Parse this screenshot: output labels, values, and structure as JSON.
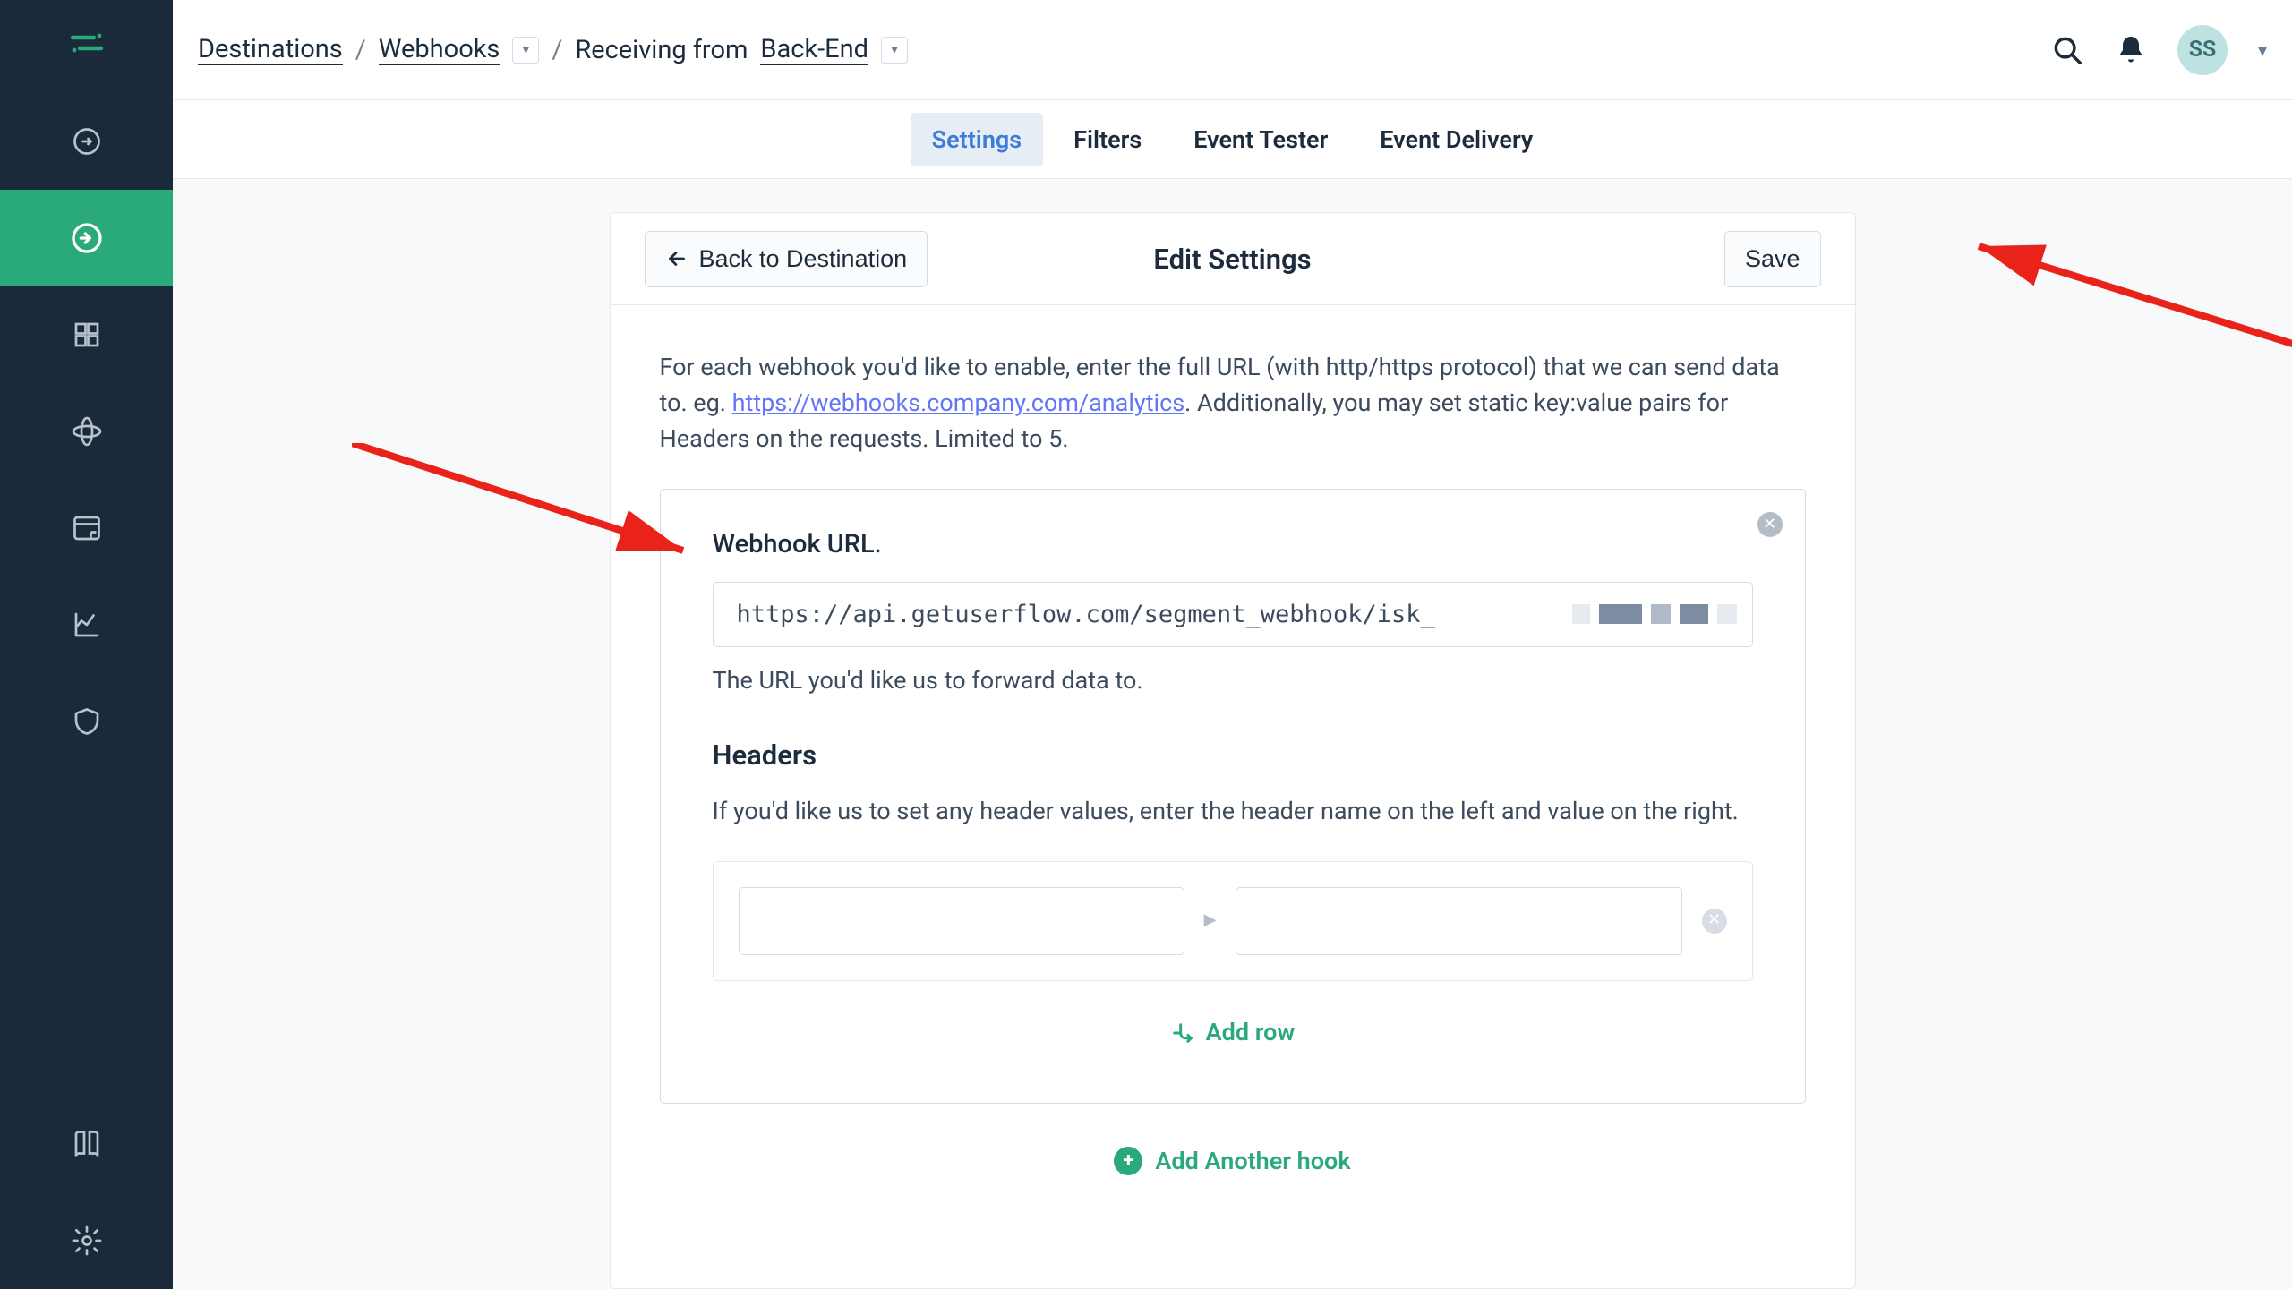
{
  "breadcrumb": {
    "destinations": "Destinations",
    "webhooks": "Webhooks",
    "receiving_from": "Receiving from",
    "backend": "Back-End"
  },
  "user": {
    "initials": "SS"
  },
  "tabs": {
    "settings": "Settings",
    "filters": "Filters",
    "event_tester": "Event Tester",
    "event_delivery": "Event Delivery"
  },
  "card": {
    "back": "Back to Destination",
    "title": "Edit Settings",
    "save": "Save",
    "body_pre": "For each webhook you'd like to enable, enter the full URL (with http/https protocol) that we can send data to. eg. ",
    "example_url": "https://webhooks.company.com/analytics",
    "body_post": ". Additionally, you may set static key:value pairs for Headers on the requests. Limited to 5.",
    "webhook_url_label": "Webhook URL.",
    "webhook_url_value": "https://api.getuserflow.com/segment_webhook/isk_",
    "url_help": "The URL you'd like us to forward data to.",
    "headers_label": "Headers",
    "headers_desc": "If you'd like us to set any header values, enter the header name on the left and value on the right.",
    "add_row": "Add row",
    "add_hook": "Add Another hook"
  }
}
